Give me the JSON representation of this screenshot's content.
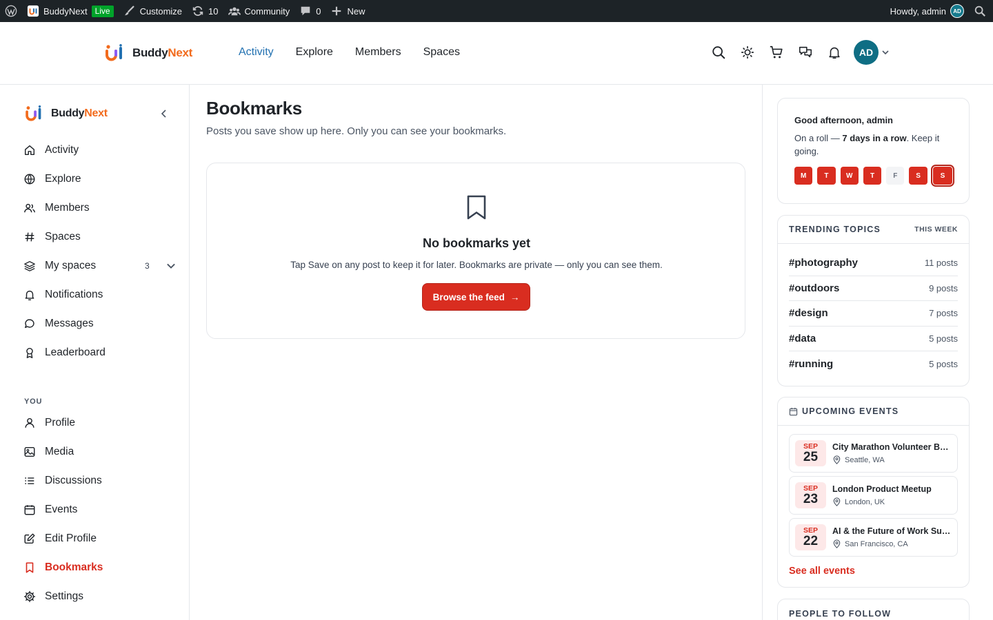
{
  "adminbar": {
    "site_name": "BuddyNext",
    "live_badge": "Live",
    "customize": "Customize",
    "updates_count": "10",
    "community": "Community",
    "comments_count": "0",
    "new": "New",
    "howdy": "Howdy, admin",
    "avatar_initials": "AD"
  },
  "header": {
    "brand_part1": "Buddy",
    "brand_part2": "Next",
    "nav": [
      "Activity",
      "Explore",
      "Members",
      "Spaces"
    ],
    "active_nav": "Activity",
    "avatar_initials": "AD"
  },
  "sidebar": {
    "brand_part1": "Buddy",
    "brand_part2": "Next",
    "main_items": [
      {
        "label": "Activity",
        "icon": "home-icon"
      },
      {
        "label": "Explore",
        "icon": "globe-icon"
      },
      {
        "label": "Members",
        "icon": "users-icon"
      },
      {
        "label": "Spaces",
        "icon": "hash-icon"
      },
      {
        "label": "My spaces",
        "icon": "layers-icon",
        "count": "3"
      },
      {
        "label": "Notifications",
        "icon": "bell-icon"
      },
      {
        "label": "Messages",
        "icon": "chat-icon"
      },
      {
        "label": "Leaderboard",
        "icon": "award-icon"
      }
    ],
    "section_label": "YOU",
    "you_items": [
      {
        "label": "Profile",
        "icon": "user-icon"
      },
      {
        "label": "Media",
        "icon": "image-icon"
      },
      {
        "label": "Discussions",
        "icon": "list-icon"
      },
      {
        "label": "Events",
        "icon": "calendar-icon"
      },
      {
        "label": "Edit Profile",
        "icon": "edit-icon"
      },
      {
        "label": "Bookmarks",
        "icon": "bookmark-icon",
        "active": true
      },
      {
        "label": "Settings",
        "icon": "gear-icon"
      }
    ]
  },
  "main": {
    "title": "Bookmarks",
    "subtitle": "Posts you save show up here. Only you can see your bookmarks.",
    "empty_title": "No bookmarks yet",
    "empty_desc": "Tap Save on any post to keep it for later. Bookmarks are private — only you can see them.",
    "browse_label": "Browse the feed",
    "browse_arrow": "→"
  },
  "greeting": {
    "title": "Good afternoon, admin",
    "text_before": "On a roll — ",
    "text_bold": "7 days in a row",
    "text_after": ". Keep it going.",
    "days": [
      {
        "label": "M",
        "active": true
      },
      {
        "label": "T",
        "active": true
      },
      {
        "label": "W",
        "active": true
      },
      {
        "label": "T",
        "active": true
      },
      {
        "label": "F",
        "active": false
      },
      {
        "label": "S",
        "active": true
      },
      {
        "label": "S",
        "active": true,
        "today": true
      }
    ]
  },
  "trending": {
    "heading": "TRENDING TOPICS",
    "period": "THIS WEEK",
    "topics": [
      {
        "tag": "#photography",
        "count": "11 posts"
      },
      {
        "tag": "#outdoors",
        "count": "9 posts"
      },
      {
        "tag": "#design",
        "count": "7 posts"
      },
      {
        "tag": "#data",
        "count": "5 posts"
      },
      {
        "tag": "#running",
        "count": "5 posts"
      }
    ]
  },
  "events": {
    "heading": "UPCOMING EVENTS",
    "items": [
      {
        "month": "SEP",
        "day": "25",
        "name": "City Marathon Volunteer Briefing",
        "location": "Seattle, WA"
      },
      {
        "month": "SEP",
        "day": "23",
        "name": "London Product Meetup",
        "location": "London, UK"
      },
      {
        "month": "SEP",
        "day": "22",
        "name": "AI & the Future of Work Summit",
        "location": "San Francisco, CA"
      }
    ],
    "see_all": "See all events"
  },
  "follow": {
    "heading": "PEOPLE TO FOLLOW"
  },
  "colors": {
    "accent_red": "#d92d20",
    "link_blue": "#2271b1",
    "brand_orange": "#f26b1d",
    "adminbar_bg": "#1d2327",
    "avatar_teal": "#0f6e84"
  }
}
